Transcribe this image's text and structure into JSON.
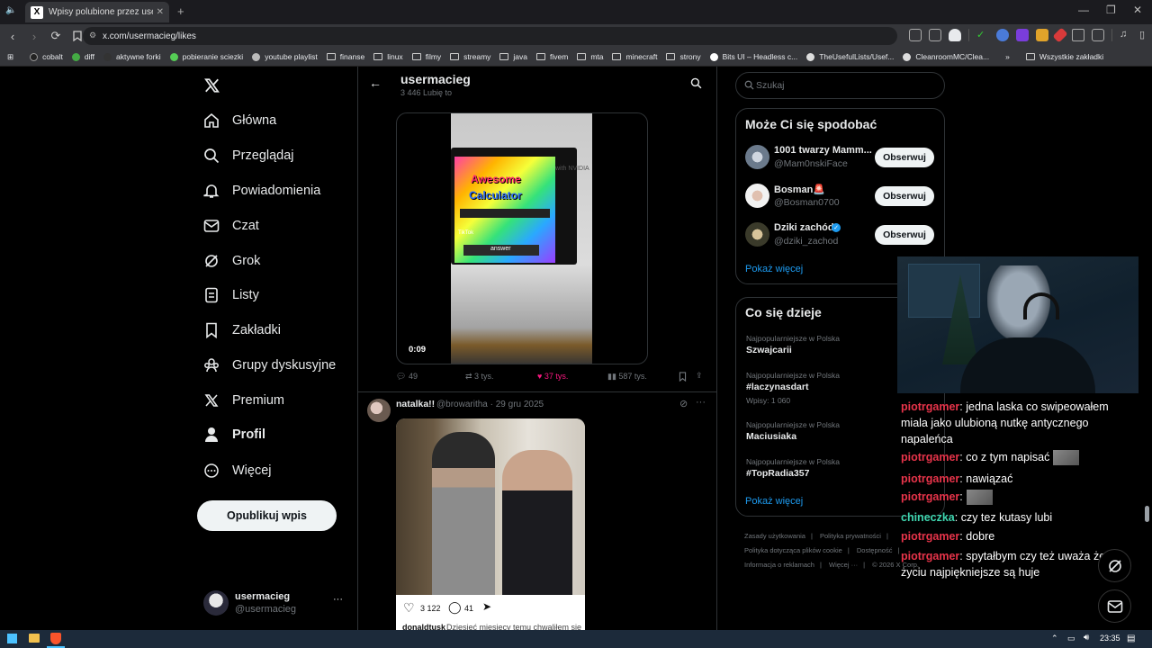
{
  "browser": {
    "tab_title": "Wpisy polubione przez usermacieg",
    "tab_favicon": "X",
    "url": "x.com/usermacieg/likes",
    "bookmarks": [
      "cobalt",
      "diff",
      "aktywne forki",
      "pobieranie sciezki",
      "youtube playlist",
      "finanse",
      "linux",
      "filmy",
      "streamy",
      "java",
      "fivem",
      "mta",
      "minecraft",
      "strony",
      "Bits UI – Headless c...",
      "TheUsefulLists/Usef...",
      "CleanroomMC/Clea..."
    ],
    "all_bookmarks": "Wszystkie zakładki"
  },
  "sidebar": {
    "items": [
      {
        "label": "Główna",
        "icon": "home-icon"
      },
      {
        "label": "Przeglądaj",
        "icon": "search-icon"
      },
      {
        "label": "Powiadomienia",
        "icon": "bell-icon"
      },
      {
        "label": "Czat",
        "icon": "mail-icon"
      },
      {
        "label": "Grok",
        "icon": "grok-icon"
      },
      {
        "label": "Listy",
        "icon": "list-icon"
      },
      {
        "label": "Zakładki",
        "icon": "bookmark-icon"
      },
      {
        "label": "Grupy dyskusyjne",
        "icon": "communities-icon"
      },
      {
        "label": "Premium",
        "icon": "x-logo-icon"
      },
      {
        "label": "Profil",
        "icon": "person-icon"
      },
      {
        "label": "Więcej",
        "icon": "more-circle-icon"
      }
    ],
    "publish": "Opublikuj wpis",
    "account_name": "usermacieg",
    "account_handle": "@usermacieg",
    "more": "···"
  },
  "header": {
    "name": "usermacieg",
    "likes_count": "3 446 Lubię to"
  },
  "tweet1": {
    "video_duration": "0:09",
    "video_text_1": "Awesome",
    "video_text_2": "Calculator",
    "video_answer": "answer",
    "video_tiktok": "TikTok",
    "video_nvidia": "with NVIDIA",
    "replies": "49",
    "reposts": "3 tys.",
    "likes": "37 tys.",
    "views": "587 tys."
  },
  "tweet2": {
    "author": "natalka!!",
    "meta": "@browaritha · 29 gru 2025",
    "insta_likes": "3 122",
    "insta_comments": "41",
    "insta_user": "donaldtusk",
    "insta_caption": "Dziesięć miesięcy temu chwaliłem się"
  },
  "right": {
    "search_placeholder": "Szukaj",
    "suggest_title": "Może Ci się spodobać",
    "suggestions": [
      {
        "name": "1001 twarzy Mamm...",
        "handle": "@Mam0nskiFace",
        "button": "Obserwuj"
      },
      {
        "name": "Bosman🚨",
        "handle": "@Bosman0700",
        "button": "Obserwuj"
      },
      {
        "name": "Dziki zachód",
        "handle": "@dziki_zachod",
        "button": "Obserwuj"
      }
    ],
    "show_more": "Pokaż więcej",
    "trends_title": "Co się dzieje",
    "trends": [
      {
        "sub": "Najpopularniejsze w Polska",
        "name": "Szwajcarii",
        "posts": ""
      },
      {
        "sub": "Najpopularniejsze w Polska",
        "name": "#laczynasdart",
        "posts": "Wpisy: 1 060"
      },
      {
        "sub": "Najpopularniejsze w Polska",
        "name": "Maciusiaka",
        "posts": ""
      },
      {
        "sub": "Najpopularniejsze w Polska",
        "name": "#TopRadia357",
        "posts": ""
      }
    ],
    "show_more_2": "Pokaż więcej",
    "footer": [
      "Zasady użytkowania",
      "Polityka prywatności",
      "Polityka dotycząca plików cookie",
      "Dostępność",
      "Informacja o reklamach",
      "Więcej ···",
      "© 2026 X Corp."
    ]
  },
  "chat": [
    {
      "user": "piotrgamer",
      "color": "#e8344a",
      "text": ": jedna laska co swipeowałem"
    },
    {
      "user": "",
      "color": "#ffffff",
      "text": "miala jako ulubioną nutkę antycznego"
    },
    {
      "user": "",
      "color": "#ffffff",
      "text": "napaleńca"
    },
    {
      "user": "piotrgamer",
      "color": "#e8344a",
      "text": ": co z tym napisać"
    },
    {
      "user": "piotrgamer",
      "color": "#e8344a",
      "text": ": nawiązać"
    },
    {
      "user": "piotrgamer",
      "color": "#e8344a",
      "text": ":"
    },
    {
      "user": "chineczka",
      "color": "#3fd6b0",
      "text": ": czy tez kutasy lubi"
    },
    {
      "user": "piotrgamer",
      "color": "#e8344a",
      "text": ": dobre"
    },
    {
      "user": "piotrgamer",
      "color": "#e8344a",
      "text": ": spytałbym czy też uważa że w"
    },
    {
      "user": "",
      "color": "#ffffff",
      "text": "życiu najpiękniejsze są huje"
    }
  ],
  "taskbar": {
    "time": "23:35"
  },
  "colors": {
    "background": "#000000",
    "border": "#2f3336",
    "accent": "#1d9bf0",
    "like_pink": "#f91880"
  }
}
